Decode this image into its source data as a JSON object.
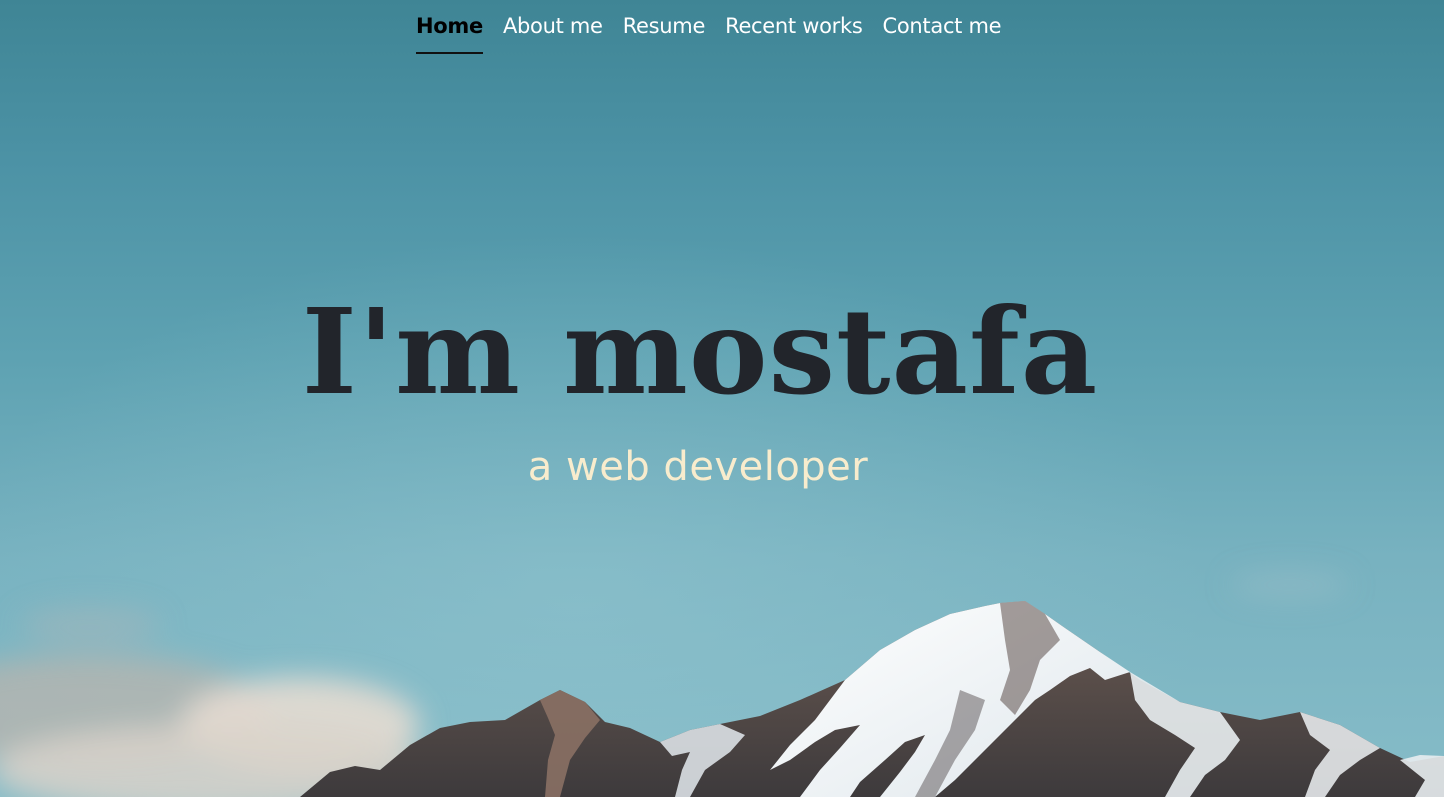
{
  "nav": {
    "items": [
      {
        "label": "Home",
        "active": true
      },
      {
        "label": "About me",
        "active": false
      },
      {
        "label": "Resume",
        "active": false
      },
      {
        "label": "Recent works",
        "active": false
      },
      {
        "label": "Contact me",
        "active": false
      }
    ]
  },
  "hero": {
    "title": "I'm mostafa",
    "subtitle": "a web developer"
  },
  "colors": {
    "sky_top": "#3f8595",
    "sky_bottom": "#86bcc8",
    "title": "#22252b",
    "subtitle": "#f8eccd",
    "nav_text": "#ffffff",
    "nav_active": "#000000"
  }
}
